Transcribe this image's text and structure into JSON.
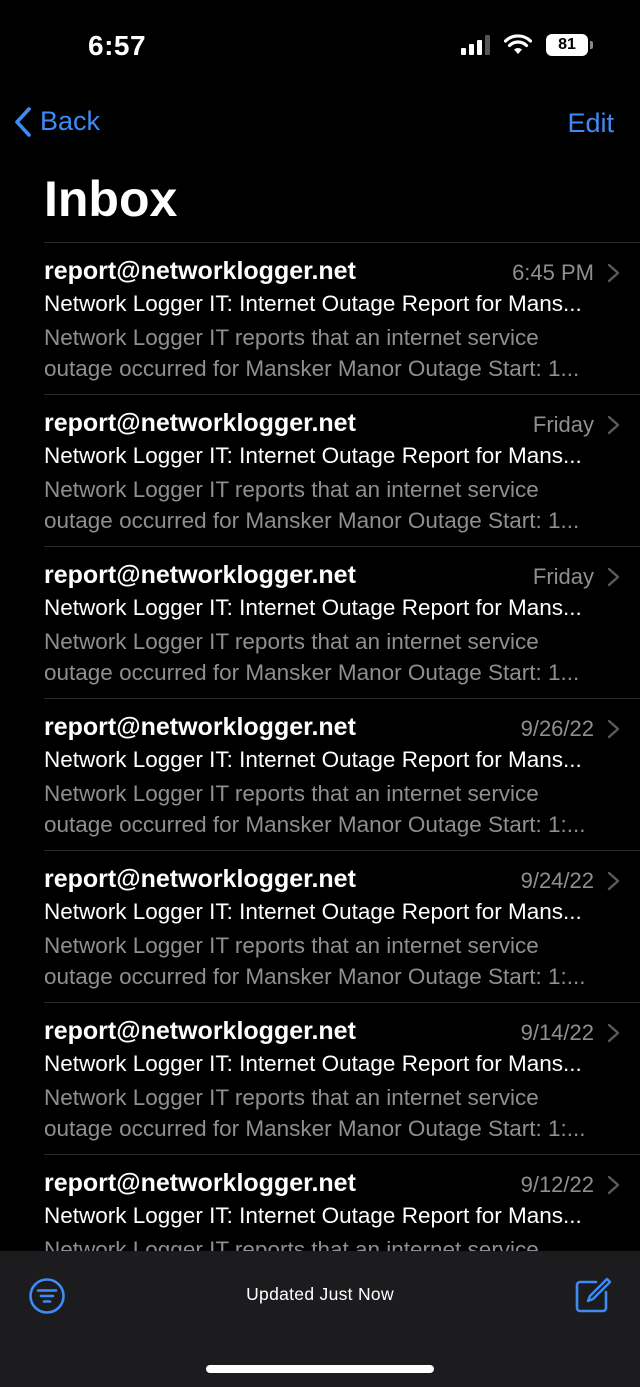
{
  "status": {
    "time": "6:57",
    "battery": "81"
  },
  "nav": {
    "back_label": "Back",
    "edit_label": "Edit",
    "title": "Inbox"
  },
  "messages": [
    {
      "sender": "report@networklogger.net",
      "date": "6:45 PM",
      "subject": "Network Logger IT: Internet Outage Report for Mans...",
      "preview_line1": "Network Logger IT reports that an internet service",
      "preview_line2": "outage occurred for Mansker Manor Outage Start: 1..."
    },
    {
      "sender": "report@networklogger.net",
      "date": "Friday",
      "subject": "Network Logger IT: Internet Outage Report for Mans...",
      "preview_line1": "Network Logger IT reports that an internet service",
      "preview_line2": "outage occurred for Mansker Manor Outage Start: 1..."
    },
    {
      "sender": "report@networklogger.net",
      "date": "Friday",
      "subject": "Network Logger IT: Internet Outage Report for Mans...",
      "preview_line1": "Network Logger IT reports that an internet service",
      "preview_line2": "outage occurred for Mansker Manor Outage Start: 1..."
    },
    {
      "sender": "report@networklogger.net",
      "date": "9/26/22",
      "subject": "Network Logger IT: Internet Outage Report for Mans...",
      "preview_line1": "Network Logger IT reports that an internet service",
      "preview_line2": "outage occurred for Mansker Manor Outage Start: 1:..."
    },
    {
      "sender": "report@networklogger.net",
      "date": "9/24/22",
      "subject": "Network Logger IT: Internet Outage Report for Mans...",
      "preview_line1": "Network Logger IT reports that an internet service",
      "preview_line2": "outage occurred for Mansker Manor Outage Start: 1:..."
    },
    {
      "sender": "report@networklogger.net",
      "date": "9/14/22",
      "subject": "Network Logger IT: Internet Outage Report for Mans...",
      "preview_line1": "Network Logger IT reports that an internet service",
      "preview_line2": "outage occurred for Mansker Manor Outage Start: 1:..."
    },
    {
      "sender": "report@networklogger.net",
      "date": "9/12/22",
      "subject": "Network Logger IT: Internet Outage Report for Mans...",
      "preview_line1": "Network Logger IT reports that an internet service",
      "preview_line2": ""
    }
  ],
  "toolbar": {
    "status_text": "Updated Just Now"
  },
  "colors": {
    "accent": "#3e8bf6",
    "secondary_text": "#8e8e93",
    "toolbar_bg": "#1c1c1e"
  }
}
